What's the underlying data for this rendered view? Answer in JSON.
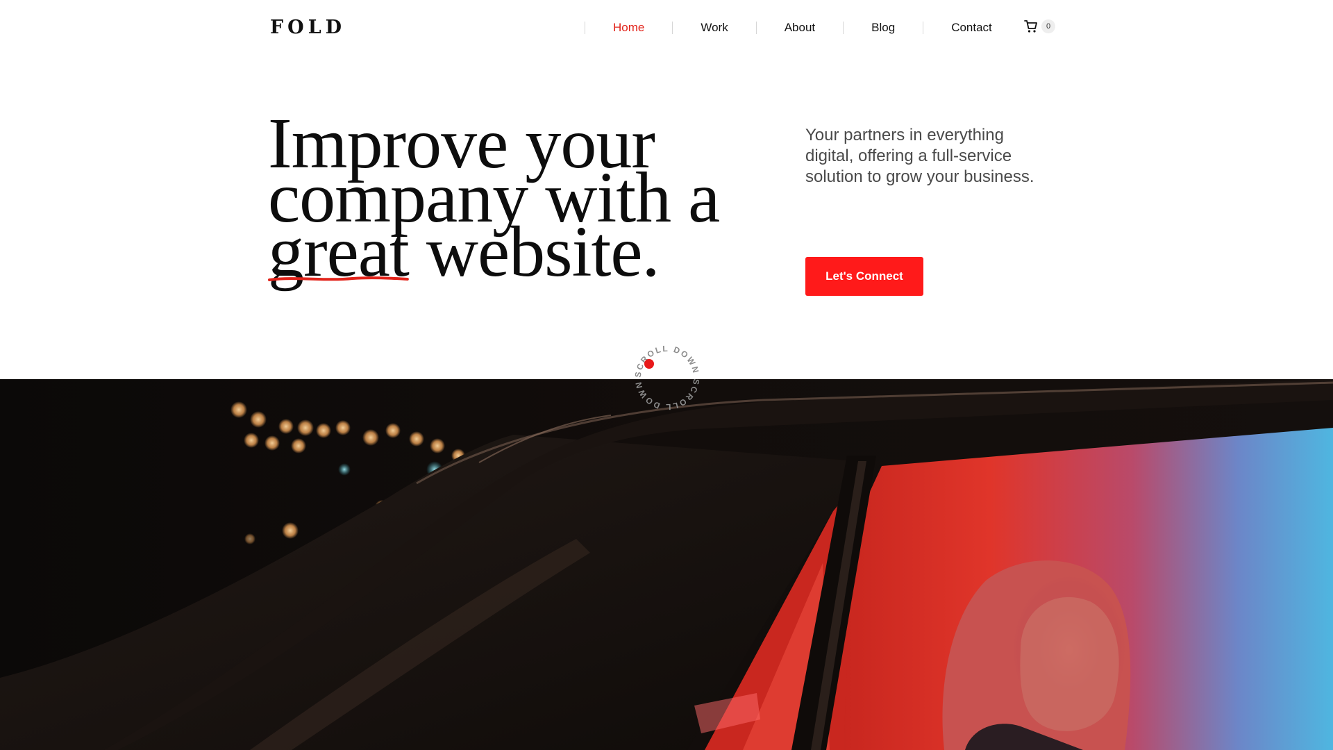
{
  "brand": {
    "logo": "FOLD"
  },
  "nav": {
    "items": [
      {
        "label": "Home",
        "active": true
      },
      {
        "label": "Work",
        "active": false
      },
      {
        "label": "About",
        "active": false
      },
      {
        "label": "Blog",
        "active": false
      },
      {
        "label": "Contact",
        "active": false
      }
    ],
    "cart_icon": "cart-icon",
    "cart_count": "0"
  },
  "hero": {
    "title_line1": "Improve your",
    "title_line2": "company with a",
    "title_highlight": "great",
    "title_line3_rest": " website.",
    "description": "Your partners in everything digital, offering a full-service solution to grow your business.",
    "cta_label": "Let's Connect"
  },
  "scroll_badge": {
    "text": "SCROLL DOWN SCROLL DOWN "
  },
  "colors": {
    "accent": "#e2231a",
    "button": "#ff1a1a",
    "text": "#111111",
    "muted_text": "#4a4a4a"
  }
}
